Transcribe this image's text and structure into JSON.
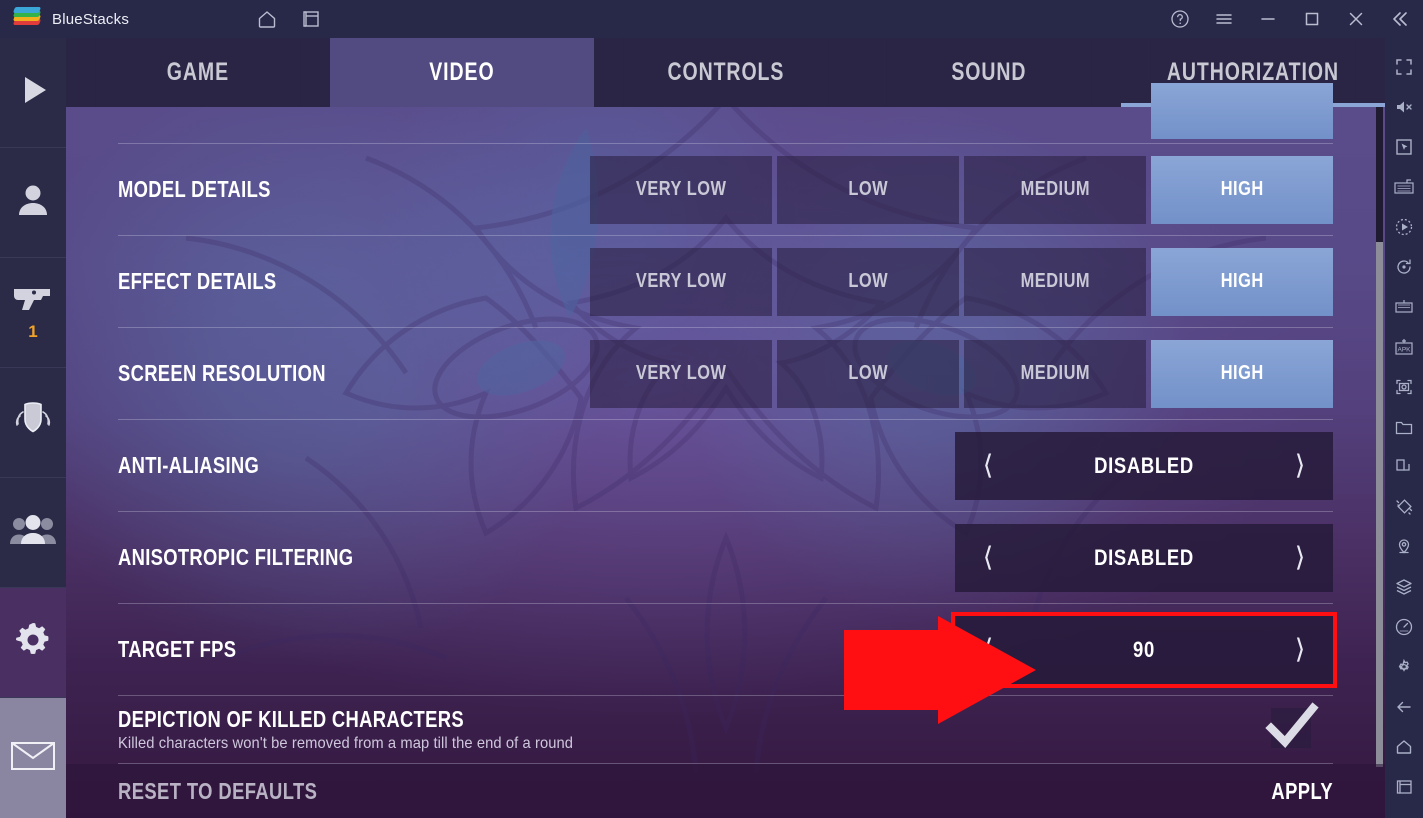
{
  "titlebar": {
    "app_name": "BlueStacks",
    "logo_icon": "bluestacks-logo",
    "mid_icons": [
      {
        "name": "home-icon",
        "label": "Home"
      },
      {
        "name": "multi-instance-icon",
        "label": "Instances"
      }
    ],
    "right_icons": [
      {
        "name": "help-icon",
        "label": "Help"
      },
      {
        "name": "menu-icon",
        "label": "Menu"
      },
      {
        "name": "minimize-icon",
        "label": "Minimize"
      },
      {
        "name": "maximize-icon",
        "label": "Maximize"
      },
      {
        "name": "close-icon",
        "label": "Close"
      },
      {
        "name": "collapse-icon",
        "label": "Collapse sidebar"
      }
    ]
  },
  "sidebar": {
    "items": [
      {
        "name": "sidebar-item-play",
        "icon": "play-icon",
        "badge": "",
        "active": false
      },
      {
        "name": "sidebar-item-profile",
        "icon": "person-icon",
        "badge": "",
        "active": false
      },
      {
        "name": "sidebar-item-weapons",
        "icon": "pistol-icon",
        "badge": "1",
        "active": false
      },
      {
        "name": "sidebar-item-clan",
        "icon": "shield-laurel-icon",
        "badge": "",
        "active": false
      },
      {
        "name": "sidebar-item-friends",
        "icon": "people-group-icon",
        "badge": "",
        "active": false
      },
      {
        "name": "sidebar-item-settings",
        "icon": "gear-icon",
        "badge": "",
        "active": true
      },
      {
        "name": "sidebar-item-mail",
        "icon": "envelope-icon",
        "badge": "",
        "active": false
      }
    ]
  },
  "right_toolbar": {
    "icons": [
      "fullscreen-icon",
      "mute-icon",
      "cursor-icon",
      "keyboard-controls-icon",
      "macro-record-icon",
      "rotate-icon",
      "multi-instance-manager-icon",
      "install-apk-icon",
      "screenshot-icon",
      "media-folder-icon",
      "resize-window-icon",
      "shake-icon",
      "location-icon",
      "layers-icon",
      "performance-icon",
      "gear-icon",
      "back-arrow-icon",
      "home-icon",
      "recents-icon"
    ]
  },
  "tabs": [
    {
      "label": "GAME",
      "selected": false,
      "underline": false
    },
    {
      "label": "VIDEO",
      "selected": true,
      "underline": false
    },
    {
      "label": "CONTROLS",
      "selected": false,
      "underline": false
    },
    {
      "label": "SOUND",
      "selected": false,
      "underline": false
    },
    {
      "label": "AUTHORIZATION",
      "selected": false,
      "underline": true
    }
  ],
  "settings": {
    "rows": [
      {
        "name": "row-model-details",
        "label": "MODEL DETAILS",
        "sub": "",
        "control": "options",
        "options": [
          {
            "label": "VERY LOW",
            "selected": false
          },
          {
            "label": "LOW",
            "selected": false
          },
          {
            "label": "MEDIUM",
            "selected": false
          },
          {
            "label": "HIGH",
            "selected": true
          }
        ]
      },
      {
        "name": "row-effect-details",
        "label": "EFFECT DETAILS",
        "sub": "",
        "control": "options",
        "options": [
          {
            "label": "VERY LOW",
            "selected": false
          },
          {
            "label": "LOW",
            "selected": false
          },
          {
            "label": "MEDIUM",
            "selected": false
          },
          {
            "label": "HIGH",
            "selected": true
          }
        ]
      },
      {
        "name": "row-screen-resolution",
        "label": "SCREEN RESOLUTION",
        "sub": "",
        "control": "options",
        "options": [
          {
            "label": "VERY LOW",
            "selected": false
          },
          {
            "label": "LOW",
            "selected": false
          },
          {
            "label": "MEDIUM",
            "selected": false
          },
          {
            "label": "HIGH",
            "selected": true
          }
        ]
      },
      {
        "name": "row-anti-aliasing",
        "label": "ANTI-ALIASING",
        "sub": "",
        "control": "stepper",
        "value": "DISABLED",
        "prev_icon": "chevron-left-icon",
        "next_icon": "chevron-right-icon",
        "highlighted": false
      },
      {
        "name": "row-anisotropic-filtering",
        "label": "ANISOTROPIC FILTERING",
        "sub": "",
        "control": "stepper",
        "value": "DISABLED",
        "prev_icon": "chevron-left-icon",
        "next_icon": "chevron-right-icon",
        "highlighted": false
      },
      {
        "name": "row-target-fps",
        "label": "TARGET FPS",
        "sub": "",
        "control": "stepper",
        "value": "90",
        "prev_icon": "chevron-left-icon",
        "next_icon": "chevron-right-icon",
        "highlighted": true
      },
      {
        "name": "row-depiction-of-killed-characters",
        "label": "DEPICTION OF KILLED CHARACTERS",
        "sub": "Killed characters won't be removed from a map till the end of a round",
        "control": "checkbox",
        "checked": true
      }
    ]
  },
  "bottom_bar": {
    "reset_label": "RESET TO DEFAULTS",
    "apply_label": "APPLY"
  },
  "annotation": {
    "arrow_icon": "red-arrow-pointing-right",
    "arrow_color": "#ff0f12",
    "highlight_target": "row-target-fps"
  },
  "colors": {
    "accent_blue": "#7f9fd4",
    "titlebar_bg": "#282848",
    "sidebar_bg": "#2b2a47",
    "tab_bg": "#2a2545",
    "tab_selected_bg": "#524b82",
    "annotation_red": "#ff0f12",
    "badge_orange": "#f0a32a"
  }
}
